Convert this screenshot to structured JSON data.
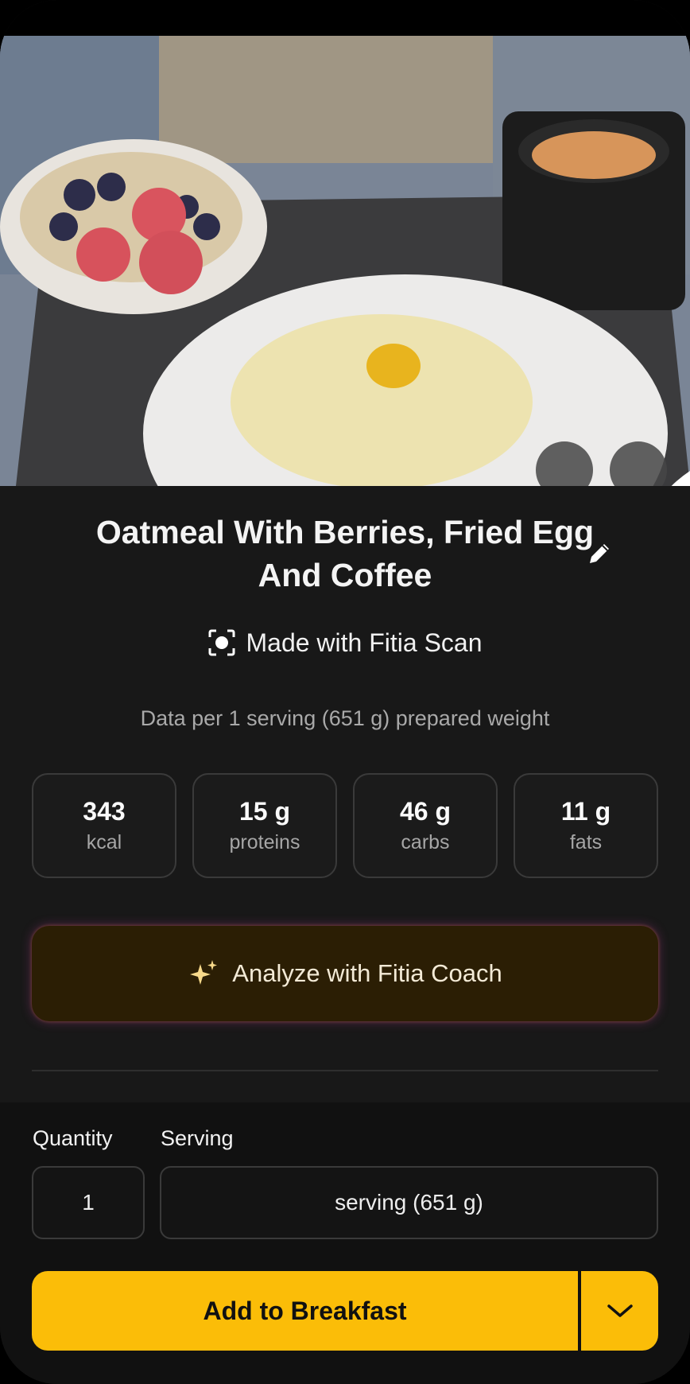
{
  "photo": {
    "alt_subject": "meal photo"
  },
  "meal": {
    "title": "Oatmeal With Berries, Fried Egg And Coffee",
    "scan_label": "Made with Fitia Scan",
    "data_per": "Data per 1 serving (651 g) prepared weight"
  },
  "macros": [
    {
      "value": "343",
      "label": "kcal"
    },
    {
      "value": "15 g",
      "label": "proteins"
    },
    {
      "value": "46 g",
      "label": "carbs"
    },
    {
      "value": "11 g",
      "label": "fats"
    }
  ],
  "coach": {
    "label": "Analyze with Fitia Coach"
  },
  "form": {
    "quantity_label": "Quantity",
    "serving_label": "Serving",
    "quantity_value": "1",
    "serving_value": "serving (651 g)"
  },
  "actions": {
    "add_label": "Add to Breakfast"
  },
  "colors": {
    "accent": "#fbbd08",
    "background": "#181818",
    "coach_bg": "#2b1e04"
  }
}
